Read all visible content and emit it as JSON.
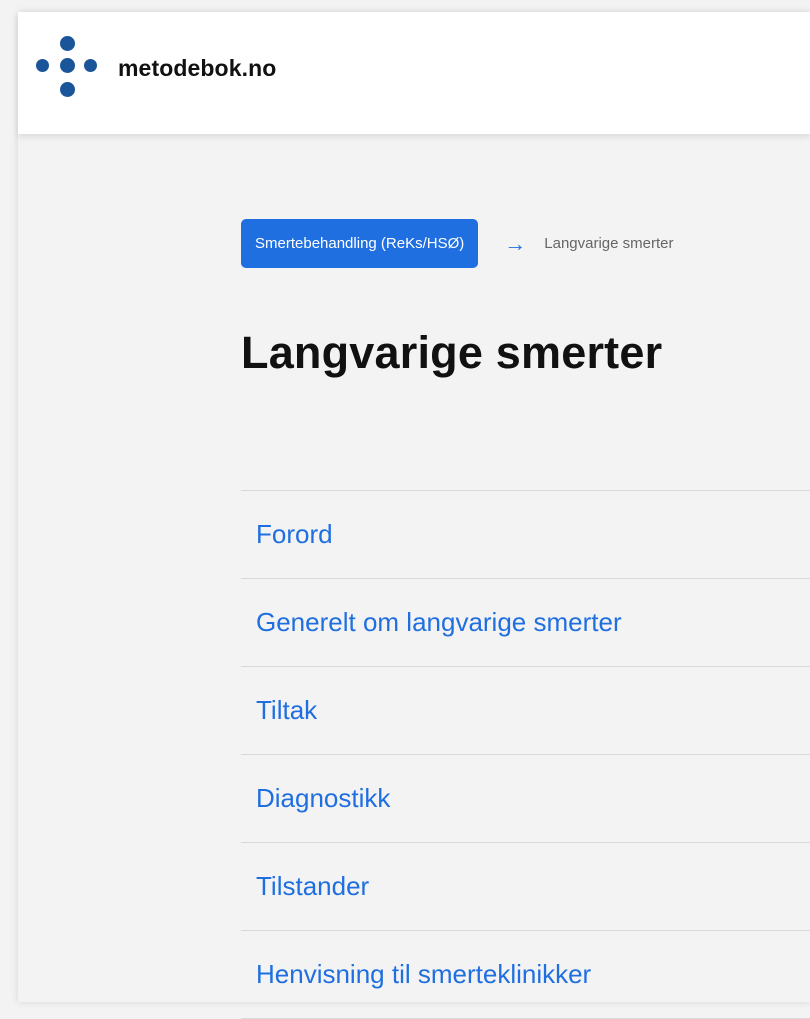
{
  "header": {
    "site_name": "metodebok.no",
    "logo_icon": "metodebok-dots-logo",
    "brand_color": "#1a5599"
  },
  "breadcrumb": {
    "parent_label": "Smertebehandling (ReKs/HSØ)",
    "separator_icon": "arrow-right-icon",
    "current_label": "Langvarige smerter"
  },
  "page": {
    "title": "Langvarige smerter"
  },
  "toc": {
    "items": [
      {
        "label": "Forord"
      },
      {
        "label": "Generelt om langvarige smerter"
      },
      {
        "label": "Tiltak"
      },
      {
        "label": "Diagnostikk"
      },
      {
        "label": "Tilstander"
      },
      {
        "label": "Henvisning til smerteklinikker"
      }
    ]
  },
  "colors": {
    "accent": "#1f6fe0",
    "text": "#111111",
    "muted": "#666666",
    "background": "#f3f3f3"
  }
}
